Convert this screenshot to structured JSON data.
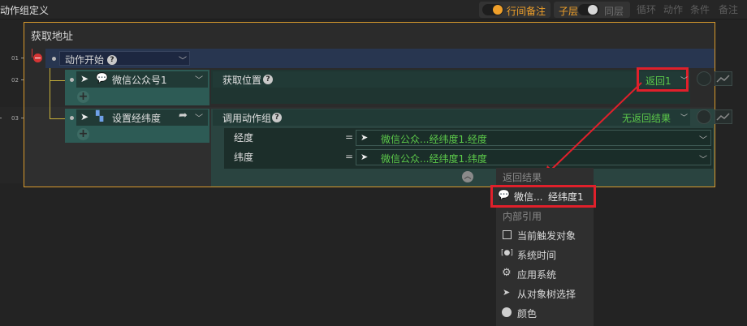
{
  "topbar": {
    "title": "动作组定义",
    "row_note_label": "行间备注",
    "child_layer_label": "子层",
    "same_layer_label": "同层",
    "buttons": [
      "循环",
      "动作",
      "条件",
      "备注"
    ]
  },
  "row_numbers": [
    "01",
    "02",
    "03"
  ],
  "frame": {
    "title": "获取地址",
    "start_row": {
      "label": "动作开始"
    },
    "node1": {
      "target_label": "微信公众号1",
      "action_label": "获取位置",
      "return_value": "返回1"
    },
    "node2": {
      "target_label": "设置经纬度",
      "action_label": "调用动作组",
      "return_value": "无返回结果",
      "params": [
        {
          "name": "经度",
          "eq": "=",
          "value": "微信公众...经纬度1.经度"
        },
        {
          "name": "纬度",
          "eq": "=",
          "value": "微信公众...经纬度1.纬度"
        }
      ]
    }
  },
  "dropdown": {
    "return_header": "返回结果",
    "highlighted_item": {
      "source": "微信...",
      "value": "经纬度1"
    },
    "internal_header": "内部引用",
    "items": [
      {
        "icon": "trigger-object-icon",
        "label": "当前触发对象"
      },
      {
        "icon": "system-time-icon",
        "label": "系统时间"
      },
      {
        "icon": "gear-icon",
        "label": "应用系统"
      },
      {
        "icon": "cursor-arrow-icon",
        "label": "从对象树选择"
      },
      {
        "icon": "palette-icon",
        "label": "颜色"
      }
    ]
  },
  "colors": {
    "accent_orange": "#f0a02a",
    "highlight_red": "#e0202b",
    "value_green": "#5cc94a",
    "teal": "#2d5b55"
  }
}
